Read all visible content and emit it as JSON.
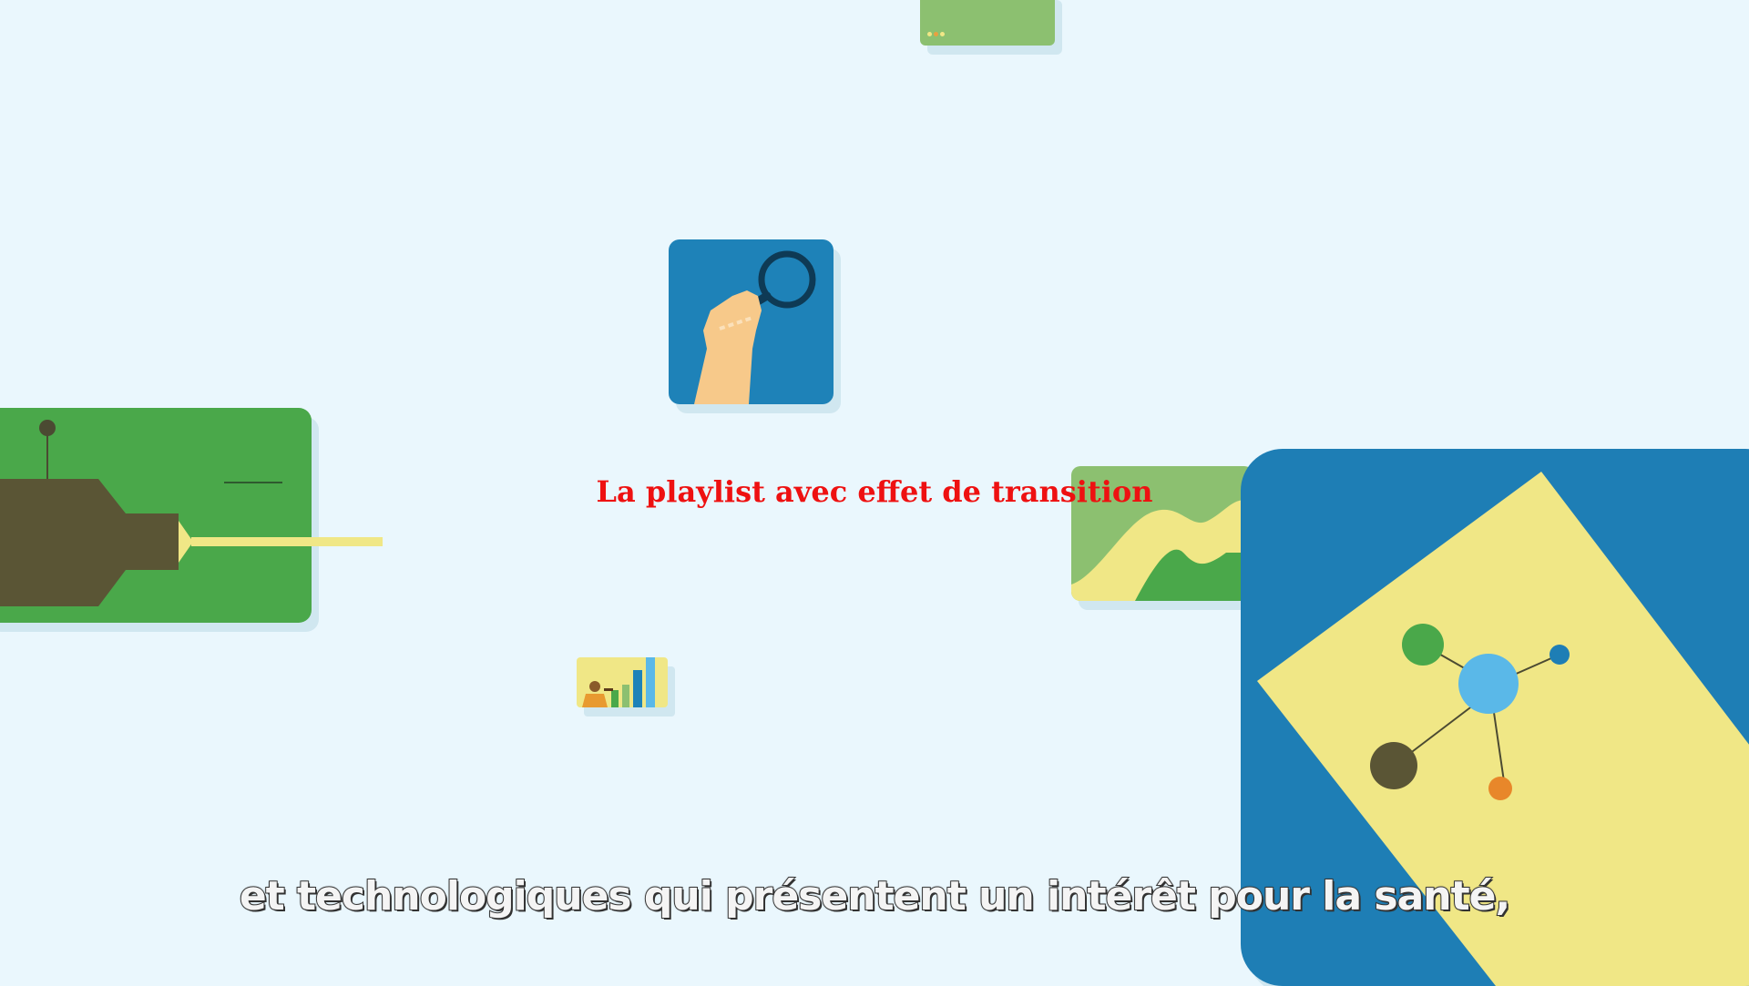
{
  "overlay": {
    "playlist_title": "La playlist avec effet de transition",
    "subtitle": "et technologiques qui présentent un intérêt pour la santé,"
  },
  "illustrations": [
    {
      "name": "top-card-icon",
      "color": "#8cc070"
    },
    {
      "name": "magnifier-hand-icon",
      "color": "#1e82b8"
    },
    {
      "name": "syringe-icon",
      "color": "#4aa84a"
    },
    {
      "name": "hills-icon",
      "color": "#8cc070"
    },
    {
      "name": "bar-chart-people-icon",
      "color": "#f0e786"
    },
    {
      "name": "molecule-icon",
      "color": "#1e7eb5"
    }
  ],
  "colors": {
    "background": "#eaf7fd",
    "title": "#ee1111",
    "subtitle_fill": "#f4f4f4",
    "subtitle_outline": "#3a3a3a"
  }
}
